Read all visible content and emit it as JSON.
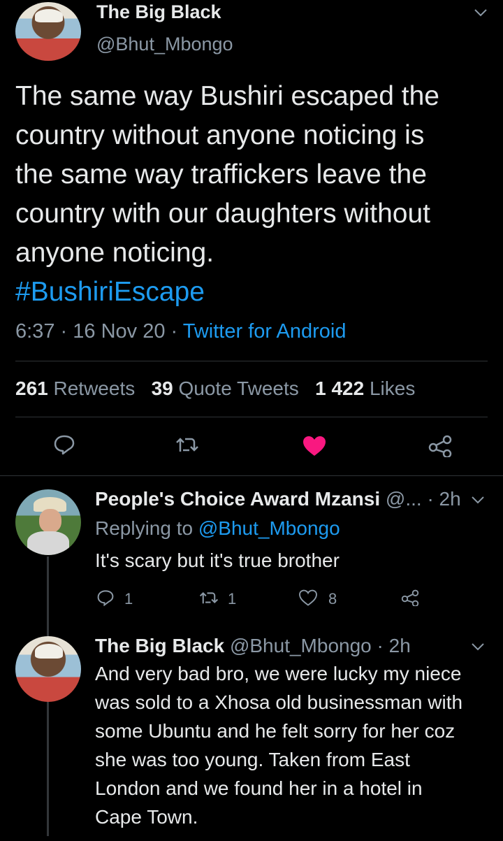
{
  "main_tweet": {
    "author_name": "The Big Black",
    "handle": "@Bhut_Mbongo",
    "text_lines": [
      "The same way Bushiri escaped the",
      "country without anyone noticing is",
      "the same way traffickers leave the",
      "country with our daughters without",
      "anyone noticing."
    ],
    "hashtag": "#BushiriEscape",
    "time": "6:37",
    "date": "16 Nov 20",
    "source": "Twitter for Android",
    "sep": "·",
    "stats": {
      "retweets_count": "261",
      "retweets_label": "Retweets",
      "quotes_count": "39",
      "quotes_label": "Quote Tweets",
      "likes_count": "1 422",
      "likes_label": "Likes"
    },
    "liked": true
  },
  "replies": [
    {
      "author_name": "People's Choice Award Mzansi",
      "handle": "@...",
      "time": "· 2h",
      "replying_prefix": "Replying to",
      "replying_handle": "@Bhut_Mbongo",
      "text": "It's scary but it's true brother",
      "reply_count": "1",
      "retweet_count": "1",
      "like_count": "8"
    },
    {
      "author_name": "The Big Black",
      "handle": "@Bhut_Mbongo",
      "time": "· 2h",
      "text_lines": [
        "And very bad bro, we were lucky my niece",
        "was sold to a Xhosa old businessman with",
        "some Ubuntu and he felt sorry for her coz",
        "she was too young. Taken from East",
        "London and we found her in a hotel in",
        "Cape Town."
      ]
    }
  ],
  "colors": {
    "background": "#000000",
    "text": "#d9d9d9",
    "muted": "#8b98a5",
    "link": "#1d9bf0",
    "like": "#f91880"
  }
}
